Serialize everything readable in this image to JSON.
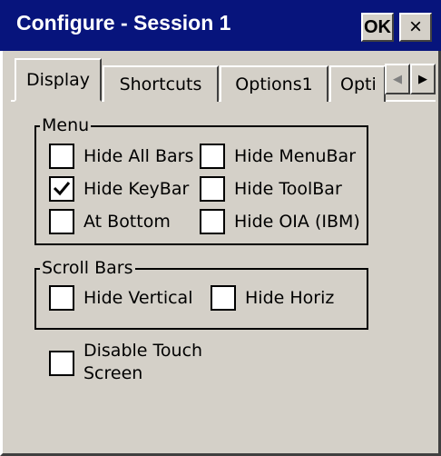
{
  "window": {
    "title": "Configure - Session 1",
    "ok_label": "OK",
    "close_label": "×"
  },
  "tabs": [
    {
      "label": "Display",
      "active": true
    },
    {
      "label": "Shortcuts",
      "active": false
    },
    {
      "label": "Options1",
      "active": false
    },
    {
      "label": "Opti",
      "active": false
    }
  ],
  "tab_scroll": {
    "left": "◀",
    "right": "▶"
  },
  "menu_group": {
    "title": "Menu",
    "items": [
      {
        "label": "Hide All Bars",
        "checked": false
      },
      {
        "label": "Hide MenuBar",
        "checked": false
      },
      {
        "label": "Hide KeyBar",
        "checked": true
      },
      {
        "label": "Hide ToolBar",
        "checked": false
      },
      {
        "label": "At Bottom",
        "checked": false
      },
      {
        "label": "Hide OIA (IBM)",
        "checked": false
      }
    ]
  },
  "scroll_group": {
    "title": "Scroll Bars",
    "items": [
      {
        "label": "Hide Vertical",
        "checked": false
      },
      {
        "label": "Hide Horiz",
        "checked": false
      }
    ]
  },
  "touch": {
    "line1": "Disable Touch",
    "line2": "Screen",
    "checked": false
  },
  "colors": {
    "titlebar": "#07147c",
    "face": "#d4d0c8"
  }
}
